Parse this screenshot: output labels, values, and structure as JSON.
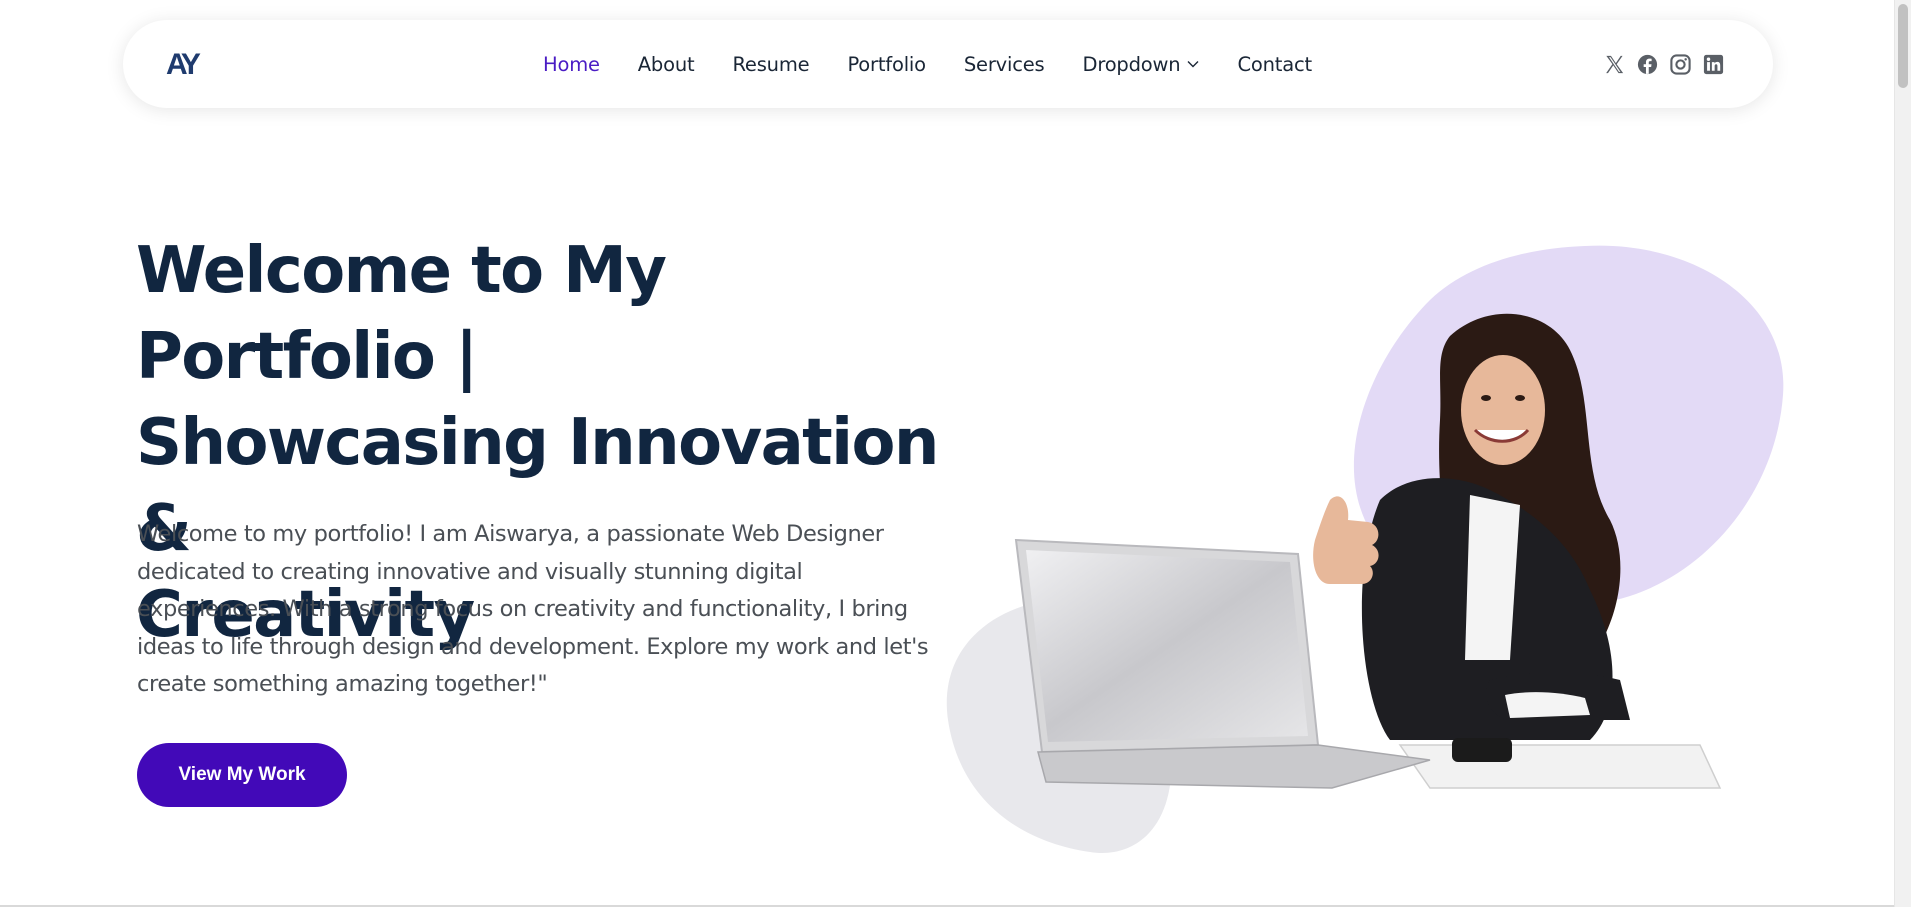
{
  "brand": {
    "logo_text": "AY",
    "accent": "#4209b8",
    "active_nav": "#4a1cc4",
    "title_color": "#112640"
  },
  "nav": {
    "items": [
      {
        "label": "Home",
        "active": true
      },
      {
        "label": "About",
        "active": false
      },
      {
        "label": "Resume",
        "active": false
      },
      {
        "label": "Portfolio",
        "active": false
      },
      {
        "label": "Services",
        "active": false
      },
      {
        "label": "Dropdown",
        "active": false
      },
      {
        "label": "Contact",
        "active": false
      }
    ]
  },
  "social": [
    "x-icon",
    "facebook-icon",
    "instagram-icon",
    "linkedin-icon"
  ],
  "hero": {
    "title_line1": "Welcome to My Portfolio |",
    "title_line2": "Showcasing Innovation &",
    "title_line3": "Creativity",
    "text": "Welcome to my portfolio! I am Aiswarya, a passionate Web Designer dedicated to creating innovative and visually stunning digital experiences. With a strong focus on creativity and functionality, I bring ideas to life through design and development. Explore my work and let's create something amazing together!\"",
    "cta_label": "View My Work"
  }
}
